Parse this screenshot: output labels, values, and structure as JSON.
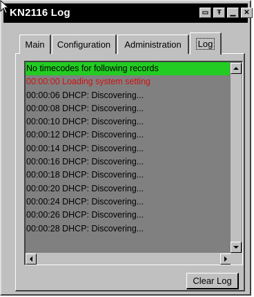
{
  "window": {
    "title": "KN2116 Log"
  },
  "tabs": [
    {
      "label": "Main"
    },
    {
      "label": "Configuration"
    },
    {
      "label": "Administration"
    },
    {
      "label": "Log"
    }
  ],
  "log": {
    "rows": [
      "No timecodes for following records",
      "00:00:00 Loading system setting",
      "00:00:06 DHCP: Discovering...",
      "00:00:08 DHCP: Discovering...",
      "00:00:10 DHCP: Discovering...",
      "00:00:12 DHCP: Discovering...",
      "00:00:14 DHCP: Discovering...",
      "00:00:16 DHCP: Discovering...",
      "00:00:18 DHCP: Discovering...",
      "00:00:20 DHCP: Discovering...",
      "00:00:24 DHCP: Discovering...",
      "00:00:26 DHCP: Discovering...",
      "00:00:28 DHCP: Discovering..."
    ],
    "highlight_color": "#22cc22",
    "error_color": "#d01010"
  },
  "buttons": {
    "clear_log": "Clear Log"
  },
  "titlebar_icons": [
    "restore-icon",
    "pin-icon",
    "minimize-icon",
    "close-icon"
  ]
}
